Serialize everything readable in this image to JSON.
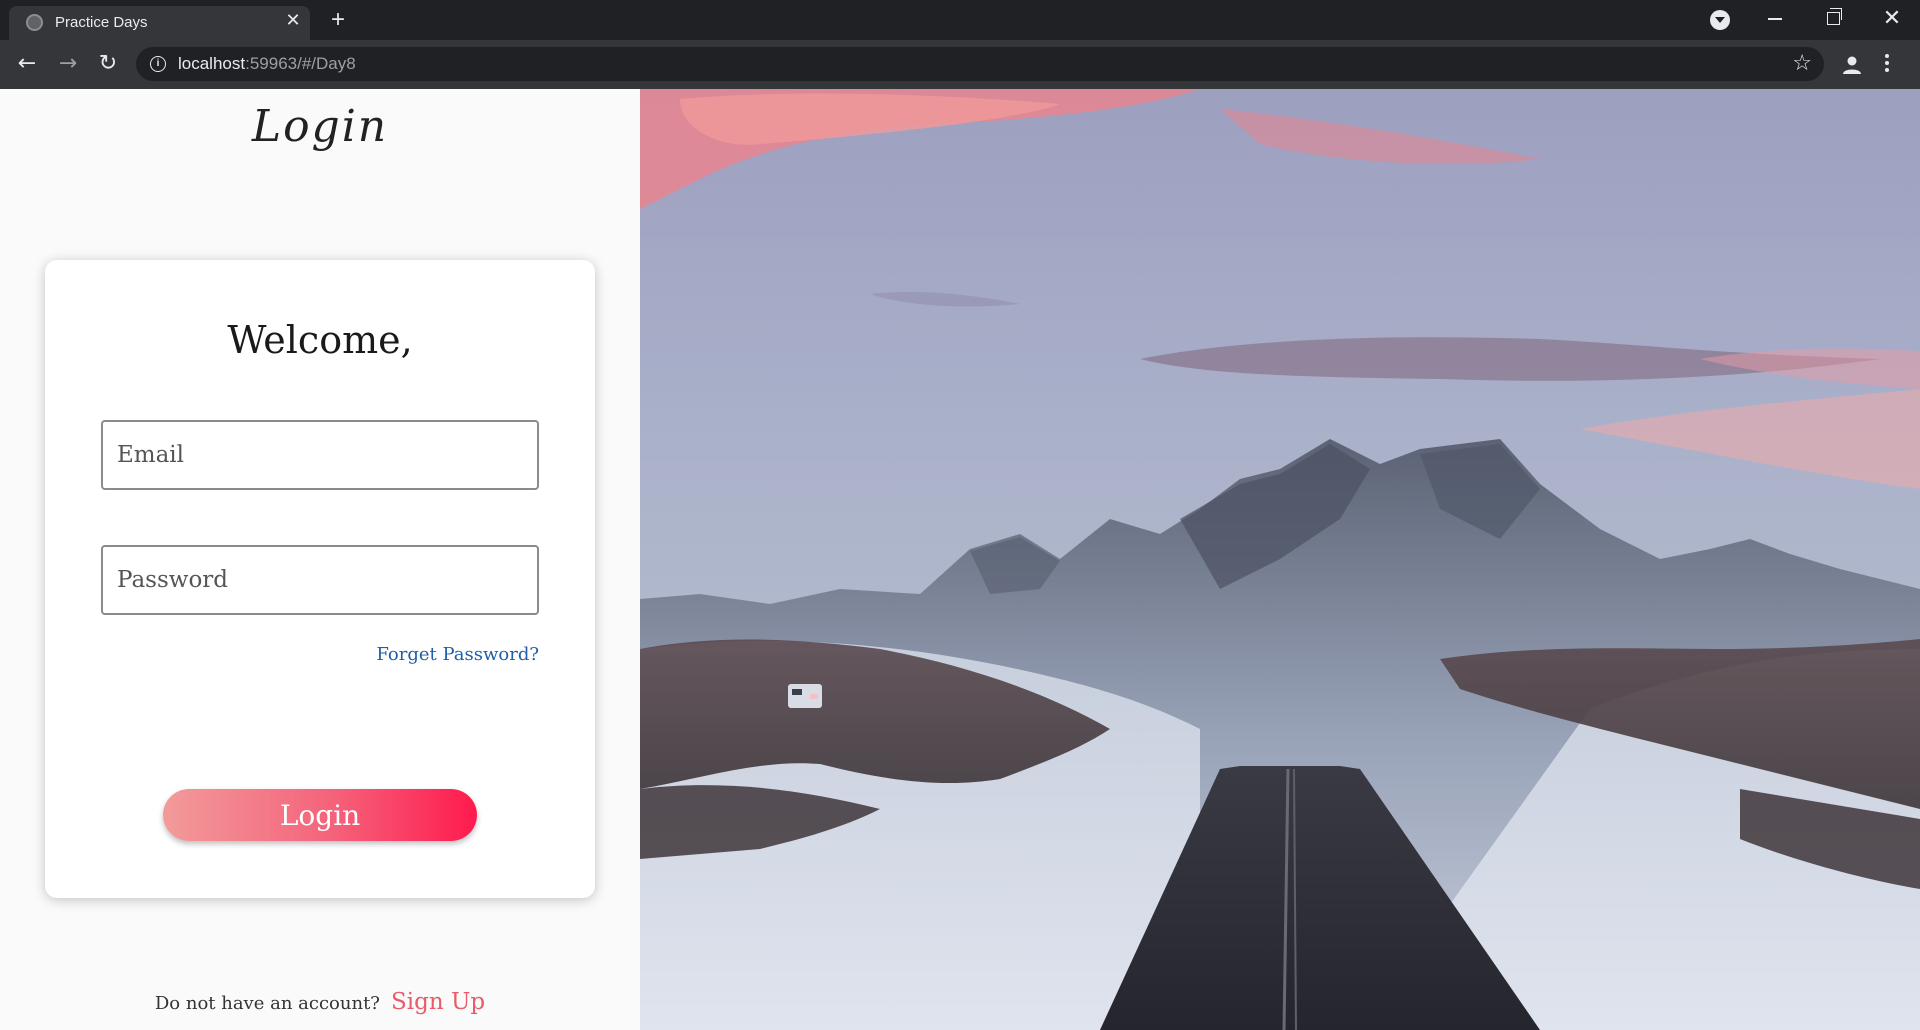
{
  "browser": {
    "tab_title": "Practice Days",
    "tab_close_glyph": "✕",
    "new_tab_glyph": "+",
    "url_host": "localhost",
    "url_rest": ":59963/#/Day8",
    "icons": [
      "page-favicon-icon",
      "tab-search-icon",
      "minimize-icon",
      "maximize-icon",
      "window-close-icon",
      "back-icon",
      "forward-icon",
      "reload-icon",
      "site-info-icon",
      "bookmark-star-icon",
      "profile-icon",
      "kebab-menu-icon"
    ]
  },
  "page": {
    "logo_text": "Login",
    "welcome": "Welcome,",
    "email_placeholder": "Email",
    "password_placeholder": "Password",
    "forgot_label": "Forget Password?",
    "login_label": "Login",
    "signup_prompt": "Do not have an account?",
    "signup_label": "Sign Up"
  },
  "colors": {
    "accent_gradient_start": "#f29b9b",
    "accent_gradient_end": "#ff1a4d",
    "link_blue": "#1e5fa8",
    "signup_pink": "#e85b6a"
  }
}
